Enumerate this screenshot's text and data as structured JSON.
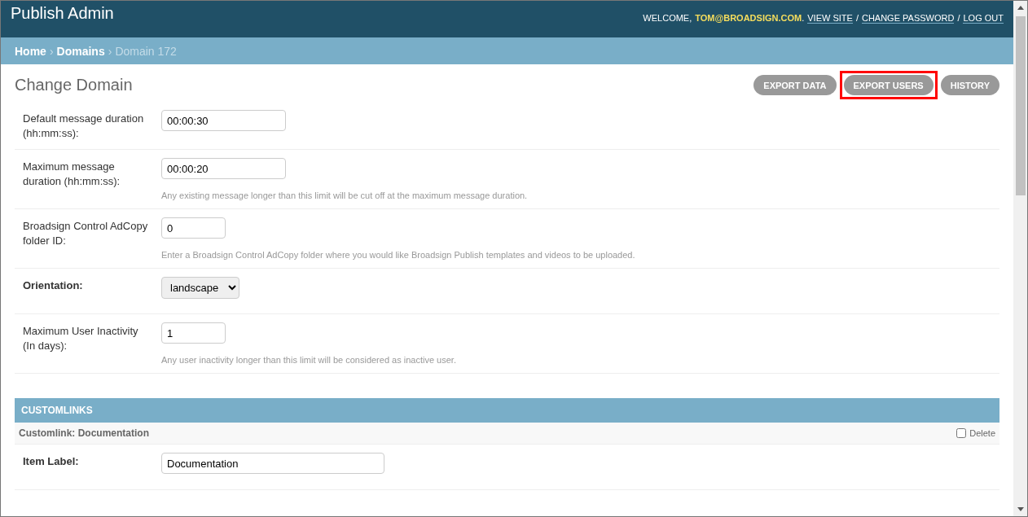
{
  "header": {
    "title": "Publish Admin",
    "welcome": "WELCOME,",
    "user": "TOM@BROADSIGN.COM",
    "user_suffix": ".",
    "links": [
      "VIEW SITE",
      "CHANGE PASSWORD",
      "LOG OUT"
    ],
    "separator": "/"
  },
  "breadcrumb_separator": "›",
  "breadcrumbs": [
    {
      "label": "Home",
      "current": false
    },
    {
      "label": "Domains",
      "current": false
    },
    {
      "label": "Domain 172",
      "current": true
    }
  ],
  "page_title": "Change Domain",
  "tools": [
    {
      "label": "EXPORT DATA",
      "highlighted": false
    },
    {
      "label": "EXPORT USERS",
      "highlighted": true
    },
    {
      "label": "HISTORY",
      "highlighted": false
    }
  ],
  "fields": [
    {
      "kind": "text",
      "label": "Default message duration (hh:mm:ss):",
      "required": false,
      "value": "00:00:30"
    },
    {
      "kind": "text",
      "label": "Maximum message duration (hh:mm:ss):",
      "required": false,
      "value": "00:00:20",
      "help": "Any existing message longer than this limit will be cut off at the maximum message duration."
    },
    {
      "kind": "text",
      "label": "Broadsign Control AdCopy folder ID:",
      "required": false,
      "value": "0",
      "help": "Enter a Broadsign Control AdCopy folder where you would like Broadsign Publish templates and videos to be uploaded."
    },
    {
      "kind": "select",
      "label": "Orientation:",
      "required": true,
      "value": "landscape"
    },
    {
      "kind": "text",
      "label": "Maximum User Inactivity (In days):",
      "required": false,
      "value": "1",
      "help": "Any user inactivity longer than this limit will be considered as inactive user."
    }
  ],
  "inline": {
    "title": "CUSTOMLINKS",
    "item_title": "Customlink: Documentation",
    "delete_label": "Delete",
    "delete_checked": false,
    "field_label": "Item Label:",
    "field_value": "Documentation"
  }
}
